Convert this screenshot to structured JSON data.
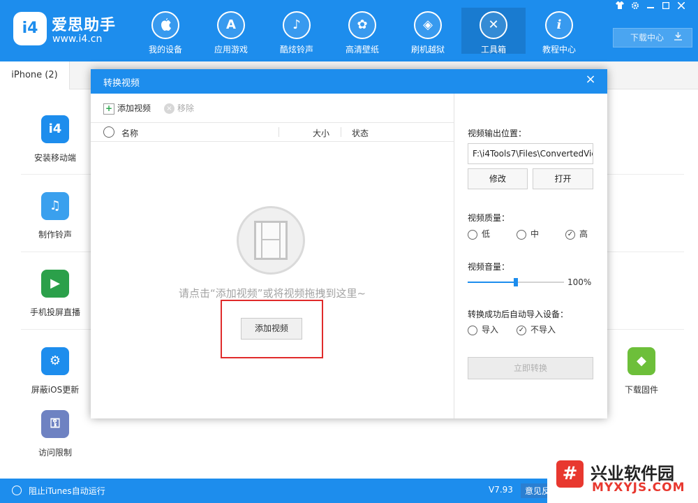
{
  "app": {
    "logo_badge": "i4",
    "name": "爱思助手",
    "url": "www.i4.cn"
  },
  "nav": {
    "items": [
      {
        "label": "我的设备",
        "icon": "apple-icon",
        "glyph": ""
      },
      {
        "label": "应用游戏",
        "icon": "app-store-icon",
        "glyph": "A"
      },
      {
        "label": "酷炫铃声",
        "icon": "bell-icon",
        "glyph": "♪"
      },
      {
        "label": "高清壁纸",
        "icon": "flower-icon",
        "glyph": "✿"
      },
      {
        "label": "刷机越狱",
        "icon": "dropbox-icon",
        "glyph": "◈"
      },
      {
        "label": "工具箱",
        "icon": "tools-icon",
        "glyph": "✕"
      },
      {
        "label": "教程中心",
        "icon": "info-icon",
        "glyph": "i"
      }
    ],
    "active_index": 5,
    "download_center": "下载中心",
    "window_controls": [
      "shirt-icon",
      "gear-icon",
      "minimize-icon",
      "maximize-icon",
      "close-icon"
    ]
  },
  "device_tab": "iPhone (2)",
  "tools": [
    {
      "label": "安装移动端",
      "icon": "i4-app-icon",
      "glyph": "i4",
      "color": "#1d8ded"
    },
    {
      "label": "制作铃声",
      "icon": "bell-plus-icon",
      "glyph": "♫",
      "color": "#3aa0ee"
    },
    {
      "label": "手机投屏直播",
      "icon": "screen-mirror-icon",
      "glyph": "▶",
      "color": "#2ba04a"
    },
    {
      "label": "屏蔽iOS更新",
      "icon": "gear-block-icon",
      "glyph": "⚙",
      "color": "#1d8ded"
    },
    {
      "label": "访问限制",
      "icon": "key-icon",
      "glyph": "⚿",
      "color": "#6e82c2"
    },
    {
      "label": "下载固件",
      "icon": "box-icon",
      "glyph": "◆",
      "color": "#6dbf3a"
    }
  ],
  "statusbar": {
    "itunes": "阻止iTunes自动运行",
    "version": "V7.93",
    "feedback": "意见反"
  },
  "watermark": {
    "badge": "#",
    "title": "兴业软件园",
    "url": "MYXYJS.COM"
  },
  "dialog": {
    "title": "转换视频",
    "close": "×",
    "toolbar": {
      "add": "添加视频",
      "remove": "移除"
    },
    "columns": {
      "name": "名称",
      "size": "大小",
      "status": "状态"
    },
    "empty_hint": "请点击“添加视频”或将视频拖拽到这里~",
    "add_button": "添加视频",
    "output_label": "视频输出位置：",
    "output_path": "F:\\i4Tools7\\Files\\ConvertedVic",
    "modify": "修改",
    "open": "打开",
    "quality_label": "视频质量：",
    "quality_options": [
      "低",
      "中",
      "高"
    ],
    "quality_selected": "高",
    "volume_label": "视频音量：",
    "volume_value": "100%",
    "volume_fraction": 0.5,
    "import_label": "转换成功后自动导入设备：",
    "import_options": [
      "导入",
      "不导入"
    ],
    "import_selected": "不导入",
    "convert": "立即转换"
  }
}
